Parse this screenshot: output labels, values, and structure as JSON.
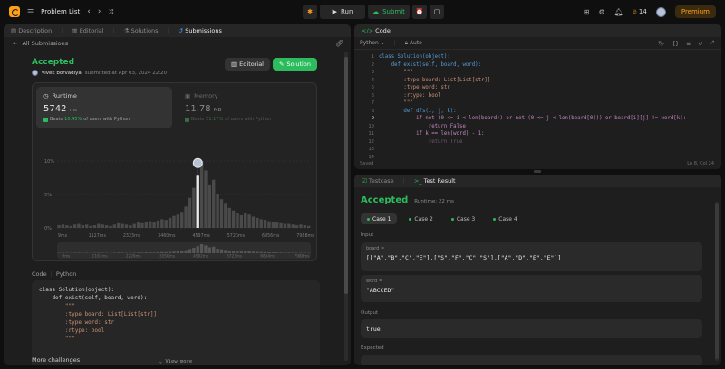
{
  "topbar": {
    "title": "Problem List",
    "run_label": "Run",
    "submit_label": "Submit",
    "streak": "14",
    "premium_label": "Premium"
  },
  "left_tabs": [
    {
      "label": "Description"
    },
    {
      "label": "Editorial"
    },
    {
      "label": "Solutions"
    },
    {
      "label": "Submissions"
    }
  ],
  "submission": {
    "back_label": "All Submissions",
    "status": "Accepted",
    "user": "vivek borvadiya",
    "submitted": "submitted at Apr 03, 2024 22:20",
    "editorial_label": "Editorial",
    "solution_label": "Solution",
    "runtime": {
      "label": "Runtime",
      "value": "5742",
      "unit": "ms",
      "beats_prefix": "Beats",
      "beats_pct": "10.45%",
      "beats_suffix": "of users with Python"
    },
    "memory": {
      "label": "Memory",
      "value": "11.78",
      "unit": "MB",
      "beats_prefix": "Beats",
      "beats_pct": "51.17%",
      "beats_suffix": "of users with Python"
    }
  },
  "chart_data": {
    "type": "bar",
    "y_ticks": [
      "10%",
      "5%",
      "0%"
    ],
    "ylim": [
      0,
      10
    ],
    "x_ticks": [
      "9ms",
      "1127ms",
      "2323ms",
      "3460ms",
      "4597ms",
      "5723ms",
      "6856ms",
      "7988ms"
    ],
    "mini_x_ticks": [
      "9ms",
      "1167ms",
      "2229ms",
      "3350ms",
      "4592ms",
      "5723ms",
      "6854ms",
      "7988ms"
    ],
    "values": [
      0.4,
      0.5,
      0.4,
      0.3,
      0.5,
      0.6,
      0.4,
      0.5,
      0.3,
      0.4,
      0.6,
      0.5,
      0.4,
      0.3,
      0.5,
      0.7,
      0.6,
      0.5,
      0.4,
      0.6,
      0.8,
      0.7,
      0.9,
      1.0,
      0.8,
      1.1,
      1.3,
      1.2,
      1.5,
      1.8,
      2.0,
      2.4,
      3.2,
      4.5,
      6.0,
      7.8,
      10.0,
      8.6,
      6.5,
      7.2,
      5.0,
      4.3,
      3.6,
      3.0,
      2.6,
      2.2,
      1.9,
      2.3,
      2.0,
      1.7,
      1.5,
      1.3,
      1.2,
      1.0,
      0.9,
      0.8,
      0.7,
      0.6,
      0.6,
      0.5,
      0.4,
      0.5,
      0.4,
      0.3
    ],
    "highlight_index": 35
  },
  "code_section": {
    "label_code": "Code",
    "label_lang": "Python",
    "view_more": "View more",
    "lines": [
      "class Solution(object):",
      "    def exist(self, board, word):",
      "        \"\"\"",
      "        :type board: List[List[str]]",
      "        :type word: str",
      "        :rtype: bool",
      "        \"\"\""
    ]
  },
  "more_challenges": "More challenges",
  "code_panel": {
    "title": "Code",
    "language": "Python",
    "auto_label": "Auto",
    "saved": "Saved",
    "cursor": "Ln 8, Col 24",
    "line_numbers": [
      "1",
      "2",
      "3",
      "4",
      "5",
      "6",
      "7",
      "8",
      "9",
      "10",
      "11",
      "12",
      "13",
      "14"
    ],
    "lines": [
      "class Solution(object):",
      "    def exist(self, board, word):",
      "        \"\"\"",
      "        :type board: List[List[str]]",
      "        :type word: str",
      "        :rtype: bool",
      "        \"\"\"",
      "",
      "        def dfs(i, j, k):",
      "            if not (0 <= i < len(board)) or not (0 <= j < len(board[0])) or board[i][j] != word[k]:",
      "                return False",
      "            if k == len(word) - 1:",
      "                return True",
      ""
    ]
  },
  "result_panel": {
    "tab_testcase": "Testcase",
    "tab_result": "Test Result",
    "status": "Accepted",
    "runtime": "Runtime: 22 ms",
    "cases": [
      "Case 1",
      "Case 2",
      "Case 3",
      "Case 4"
    ],
    "input_label": "Input",
    "board_label": "board =",
    "board_value": "[[\"A\",\"B\",\"C\",\"E\"],[\"S\",\"F\",\"C\",\"S\"],[\"A\",\"D\",\"E\",\"E\"]]",
    "word_label": "word =",
    "word_value": "\"ABCCED\"",
    "output_label": "Output",
    "output_value": "true",
    "expected_label": "Expected"
  }
}
